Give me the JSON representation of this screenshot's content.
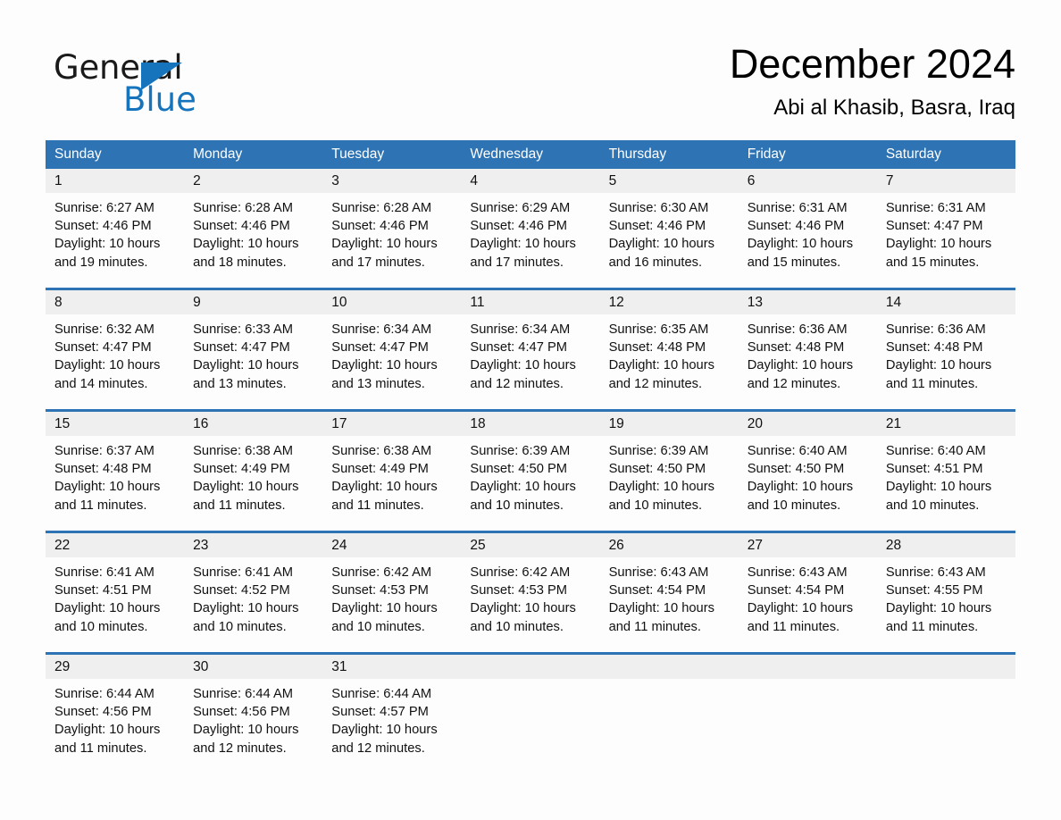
{
  "brand": {
    "name_part1": "General",
    "name_part2": "Blue",
    "flag_icon": "triangle-flag-icon",
    "accent_color": "#1574bb"
  },
  "header": {
    "title": "December 2024",
    "subtitle": "Abi al Khasib, Basra, Iraq"
  },
  "calendar": {
    "header_color": "#2e74b5",
    "day_band_color": "#efefef",
    "weekdays": [
      "Sunday",
      "Monday",
      "Tuesday",
      "Wednesday",
      "Thursday",
      "Friday",
      "Saturday"
    ],
    "weeks": [
      [
        {
          "date": "1",
          "sunrise": "Sunrise: 6:27 AM",
          "sunset": "Sunset: 4:46 PM",
          "daylight_line1": "Daylight: 10 hours",
          "daylight_line2": "and 19 minutes."
        },
        {
          "date": "2",
          "sunrise": "Sunrise: 6:28 AM",
          "sunset": "Sunset: 4:46 PM",
          "daylight_line1": "Daylight: 10 hours",
          "daylight_line2": "and 18 minutes."
        },
        {
          "date": "3",
          "sunrise": "Sunrise: 6:28 AM",
          "sunset": "Sunset: 4:46 PM",
          "daylight_line1": "Daylight: 10 hours",
          "daylight_line2": "and 17 minutes."
        },
        {
          "date": "4",
          "sunrise": "Sunrise: 6:29 AM",
          "sunset": "Sunset: 4:46 PM",
          "daylight_line1": "Daylight: 10 hours",
          "daylight_line2": "and 17 minutes."
        },
        {
          "date": "5",
          "sunrise": "Sunrise: 6:30 AM",
          "sunset": "Sunset: 4:46 PM",
          "daylight_line1": "Daylight: 10 hours",
          "daylight_line2": "and 16 minutes."
        },
        {
          "date": "6",
          "sunrise": "Sunrise: 6:31 AM",
          "sunset": "Sunset: 4:46 PM",
          "daylight_line1": "Daylight: 10 hours",
          "daylight_line2": "and 15 minutes."
        },
        {
          "date": "7",
          "sunrise": "Sunrise: 6:31 AM",
          "sunset": "Sunset: 4:47 PM",
          "daylight_line1": "Daylight: 10 hours",
          "daylight_line2": "and 15 minutes."
        }
      ],
      [
        {
          "date": "8",
          "sunrise": "Sunrise: 6:32 AM",
          "sunset": "Sunset: 4:47 PM",
          "daylight_line1": "Daylight: 10 hours",
          "daylight_line2": "and 14 minutes."
        },
        {
          "date": "9",
          "sunrise": "Sunrise: 6:33 AM",
          "sunset": "Sunset: 4:47 PM",
          "daylight_line1": "Daylight: 10 hours",
          "daylight_line2": "and 13 minutes."
        },
        {
          "date": "10",
          "sunrise": "Sunrise: 6:34 AM",
          "sunset": "Sunset: 4:47 PM",
          "daylight_line1": "Daylight: 10 hours",
          "daylight_line2": "and 13 minutes."
        },
        {
          "date": "11",
          "sunrise": "Sunrise: 6:34 AM",
          "sunset": "Sunset: 4:47 PM",
          "daylight_line1": "Daylight: 10 hours",
          "daylight_line2": "and 12 minutes."
        },
        {
          "date": "12",
          "sunrise": "Sunrise: 6:35 AM",
          "sunset": "Sunset: 4:48 PM",
          "daylight_line1": "Daylight: 10 hours",
          "daylight_line2": "and 12 minutes."
        },
        {
          "date": "13",
          "sunrise": "Sunrise: 6:36 AM",
          "sunset": "Sunset: 4:48 PM",
          "daylight_line1": "Daylight: 10 hours",
          "daylight_line2": "and 12 minutes."
        },
        {
          "date": "14",
          "sunrise": "Sunrise: 6:36 AM",
          "sunset": "Sunset: 4:48 PM",
          "daylight_line1": "Daylight: 10 hours",
          "daylight_line2": "and 11 minutes."
        }
      ],
      [
        {
          "date": "15",
          "sunrise": "Sunrise: 6:37 AM",
          "sunset": "Sunset: 4:48 PM",
          "daylight_line1": "Daylight: 10 hours",
          "daylight_line2": "and 11 minutes."
        },
        {
          "date": "16",
          "sunrise": "Sunrise: 6:38 AM",
          "sunset": "Sunset: 4:49 PM",
          "daylight_line1": "Daylight: 10 hours",
          "daylight_line2": "and 11 minutes."
        },
        {
          "date": "17",
          "sunrise": "Sunrise: 6:38 AM",
          "sunset": "Sunset: 4:49 PM",
          "daylight_line1": "Daylight: 10 hours",
          "daylight_line2": "and 11 minutes."
        },
        {
          "date": "18",
          "sunrise": "Sunrise: 6:39 AM",
          "sunset": "Sunset: 4:50 PM",
          "daylight_line1": "Daylight: 10 hours",
          "daylight_line2": "and 10 minutes."
        },
        {
          "date": "19",
          "sunrise": "Sunrise: 6:39 AM",
          "sunset": "Sunset: 4:50 PM",
          "daylight_line1": "Daylight: 10 hours",
          "daylight_line2": "and 10 minutes."
        },
        {
          "date": "20",
          "sunrise": "Sunrise: 6:40 AM",
          "sunset": "Sunset: 4:50 PM",
          "daylight_line1": "Daylight: 10 hours",
          "daylight_line2": "and 10 minutes."
        },
        {
          "date": "21",
          "sunrise": "Sunrise: 6:40 AM",
          "sunset": "Sunset: 4:51 PM",
          "daylight_line1": "Daylight: 10 hours",
          "daylight_line2": "and 10 minutes."
        }
      ],
      [
        {
          "date": "22",
          "sunrise": "Sunrise: 6:41 AM",
          "sunset": "Sunset: 4:51 PM",
          "daylight_line1": "Daylight: 10 hours",
          "daylight_line2": "and 10 minutes."
        },
        {
          "date": "23",
          "sunrise": "Sunrise: 6:41 AM",
          "sunset": "Sunset: 4:52 PM",
          "daylight_line1": "Daylight: 10 hours",
          "daylight_line2": "and 10 minutes."
        },
        {
          "date": "24",
          "sunrise": "Sunrise: 6:42 AM",
          "sunset": "Sunset: 4:53 PM",
          "daylight_line1": "Daylight: 10 hours",
          "daylight_line2": "and 10 minutes."
        },
        {
          "date": "25",
          "sunrise": "Sunrise: 6:42 AM",
          "sunset": "Sunset: 4:53 PM",
          "daylight_line1": "Daylight: 10 hours",
          "daylight_line2": "and 10 minutes."
        },
        {
          "date": "26",
          "sunrise": "Sunrise: 6:43 AM",
          "sunset": "Sunset: 4:54 PM",
          "daylight_line1": "Daylight: 10 hours",
          "daylight_line2": "and 11 minutes."
        },
        {
          "date": "27",
          "sunrise": "Sunrise: 6:43 AM",
          "sunset": "Sunset: 4:54 PM",
          "daylight_line1": "Daylight: 10 hours",
          "daylight_line2": "and 11 minutes."
        },
        {
          "date": "28",
          "sunrise": "Sunrise: 6:43 AM",
          "sunset": "Sunset: 4:55 PM",
          "daylight_line1": "Daylight: 10 hours",
          "daylight_line2": "and 11 minutes."
        }
      ],
      [
        {
          "date": "29",
          "sunrise": "Sunrise: 6:44 AM",
          "sunset": "Sunset: 4:56 PM",
          "daylight_line1": "Daylight: 10 hours",
          "daylight_line2": "and 11 minutes."
        },
        {
          "date": "30",
          "sunrise": "Sunrise: 6:44 AM",
          "sunset": "Sunset: 4:56 PM",
          "daylight_line1": "Daylight: 10 hours",
          "daylight_line2": "and 12 minutes."
        },
        {
          "date": "31",
          "sunrise": "Sunrise: 6:44 AM",
          "sunset": "Sunset: 4:57 PM",
          "daylight_line1": "Daylight: 10 hours",
          "daylight_line2": "and 12 minutes."
        },
        {
          "date": "",
          "sunrise": "",
          "sunset": "",
          "daylight_line1": "",
          "daylight_line2": ""
        },
        {
          "date": "",
          "sunrise": "",
          "sunset": "",
          "daylight_line1": "",
          "daylight_line2": ""
        },
        {
          "date": "",
          "sunrise": "",
          "sunset": "",
          "daylight_line1": "",
          "daylight_line2": ""
        },
        {
          "date": "",
          "sunrise": "",
          "sunset": "",
          "daylight_line1": "",
          "daylight_line2": ""
        }
      ]
    ]
  }
}
